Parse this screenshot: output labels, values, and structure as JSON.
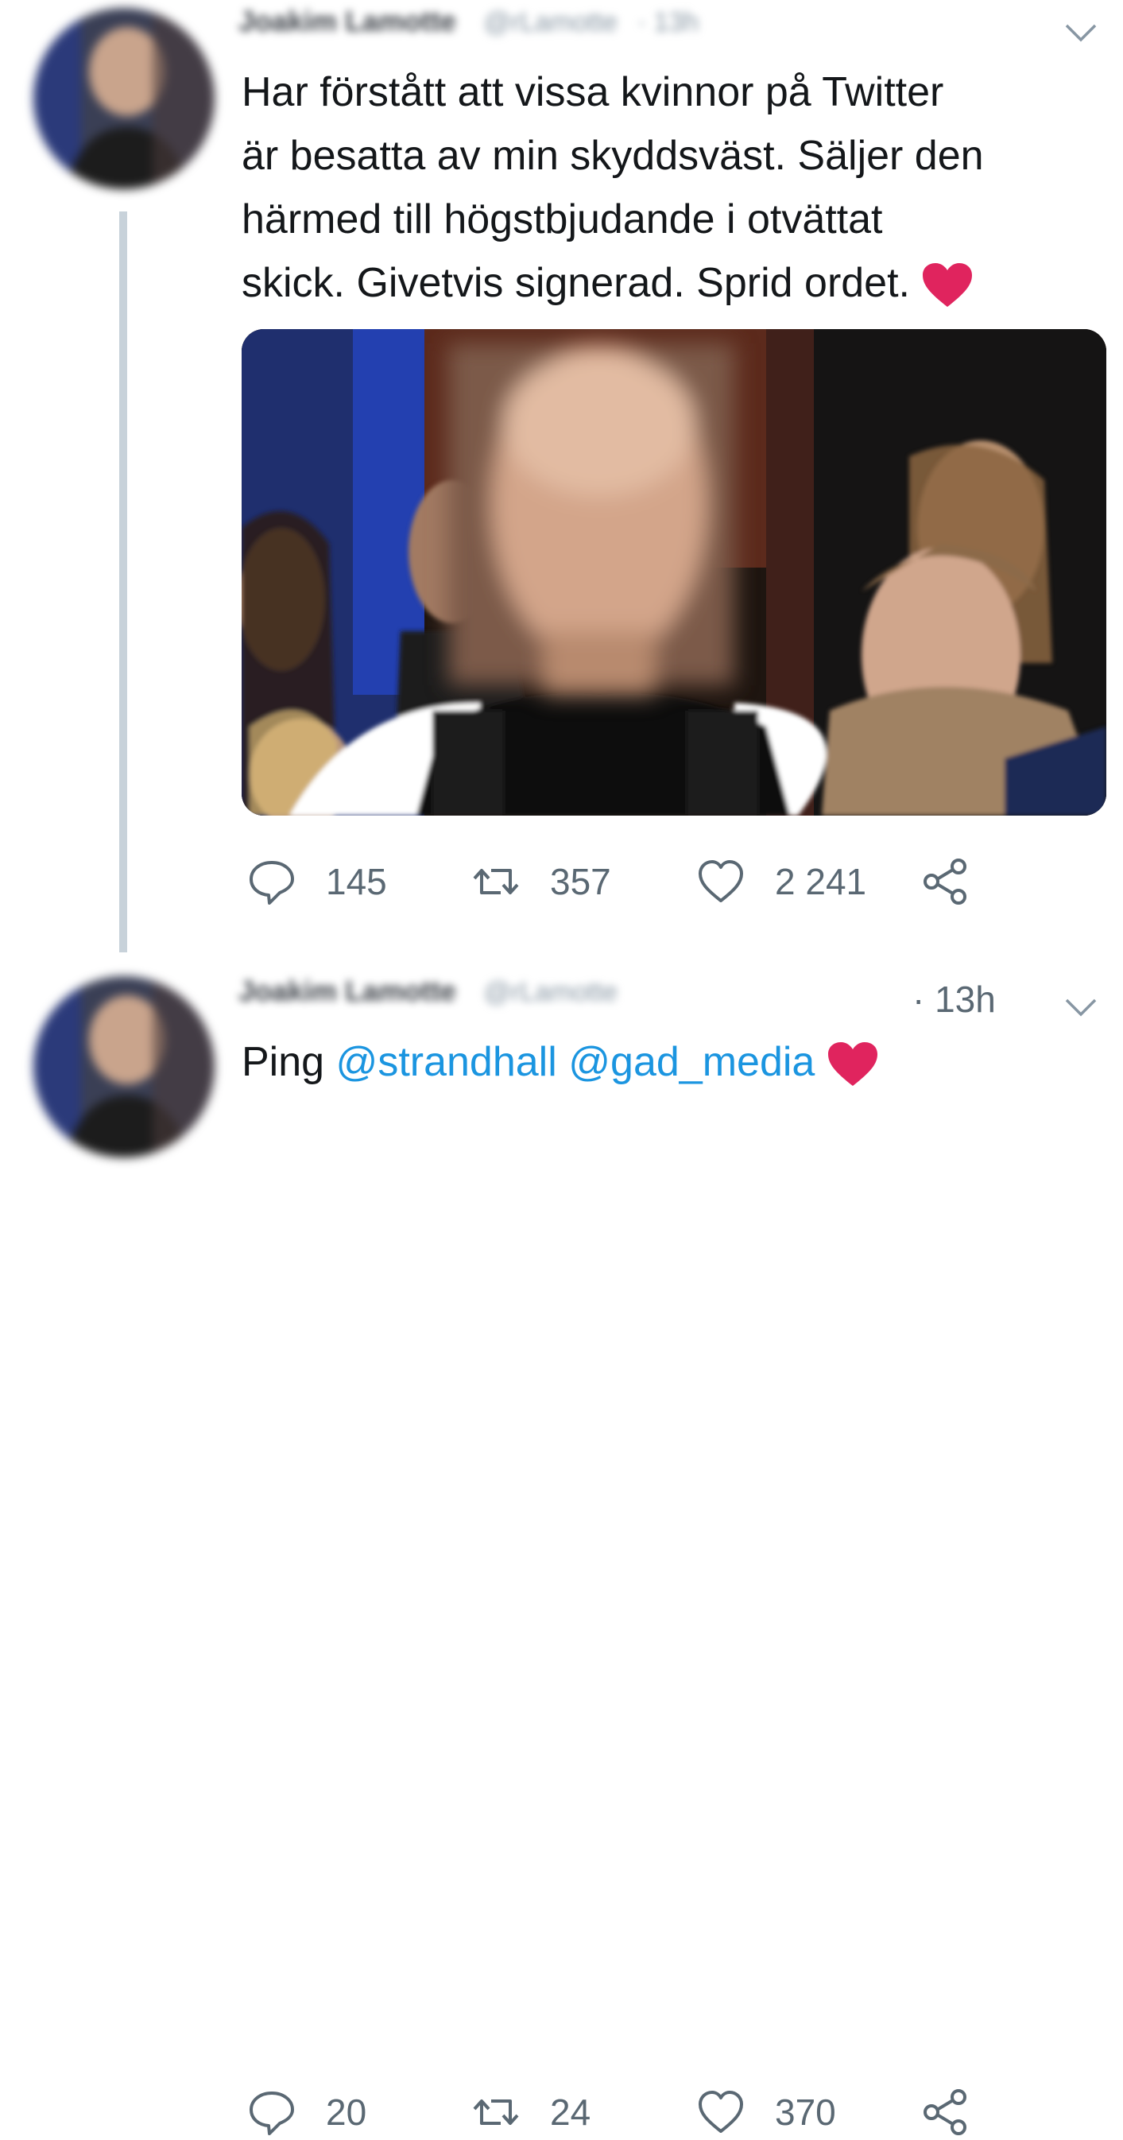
{
  "tweets": [
    {
      "author_name": "Joakim Lamotte",
      "author_handle": "@rLamotte",
      "time_blurred": "· 13h",
      "lines": [
        "Har förstått att vissa kvinnor på Twitter",
        "är besatta av min skyddsväst. Säljer den",
        "härmed till högstbjudande i otvättat",
        "skick. Givetvis signerad. Sprid ordet."
      ],
      "emoji": "heart",
      "actions": {
        "replies": "145",
        "retweets": "357",
        "likes": "2 241"
      }
    },
    {
      "author_name": "Joakim Lamotte",
      "author_handle": "@rLamotte",
      "time": "· 13h",
      "text_prefix": "Ping ",
      "mentions": [
        "@strandhall",
        "@gad_media"
      ],
      "emoji": "heart",
      "actions": {
        "replies": "20",
        "retweets": "24",
        "likes": "370"
      }
    }
  ],
  "colors": {
    "text": "#14171a",
    "muted": "#5a6873",
    "mention": "#1b95e0",
    "heart": "#e0245e",
    "thread_line": "#c8d2da"
  },
  "icons": [
    "reply-icon",
    "retweet-icon",
    "like-icon",
    "share-icon",
    "chevron-down-icon",
    "heart-emoji"
  ]
}
